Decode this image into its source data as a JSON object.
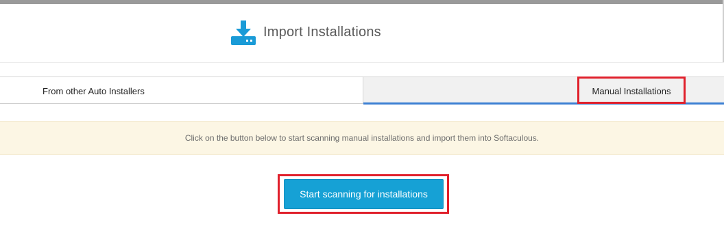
{
  "header": {
    "icon": "download-tray-icon",
    "title": "Import Installations"
  },
  "tabs": [
    {
      "label": "From other Auto Installers",
      "active": false
    },
    {
      "label": "Manual Installations",
      "active": true
    }
  ],
  "notice": {
    "text": "Click on the button below to start scanning manual installations and import them into Softaculous."
  },
  "actions": {
    "scan_label": "Start scanning for installations"
  },
  "colors": {
    "accent": "#16a1d5",
    "highlight": "#e0202b",
    "tab_active_underline": "#3b7fd3",
    "notice_background": "#fcf6e4"
  }
}
